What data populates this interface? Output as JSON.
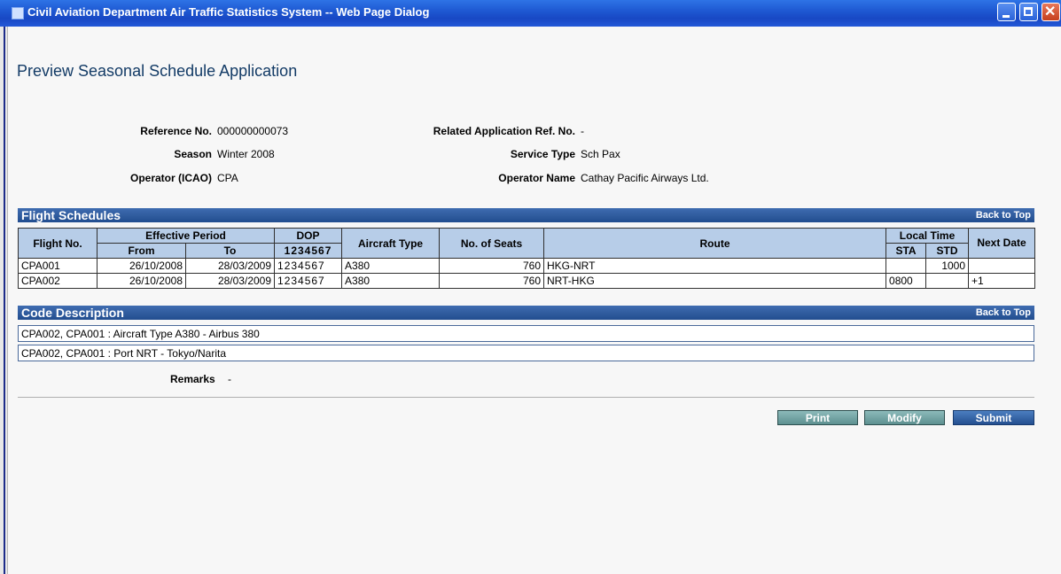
{
  "window": {
    "title": "Civil Aviation Department Air Traffic Statistics System -- Web Page Dialog"
  },
  "page": {
    "title": "Preview Seasonal Schedule Application"
  },
  "summary": {
    "ref_no_label": "Reference No.",
    "ref_no_value": "000000000073",
    "related_label": "Related Application Ref. No.",
    "related_value": "-",
    "season_label": "Season",
    "season_value": "Winter 2008",
    "service_type_label": "Service Type",
    "service_type_value": "Sch Pax",
    "operator_icao_label": "Operator (ICAO)",
    "operator_icao_value": "CPA",
    "operator_name_label": "Operator Name",
    "operator_name_value": "Cathay Pacific Airways Ltd."
  },
  "flight_schedules": {
    "title": "Flight Schedules",
    "back_to_top": "Back to Top",
    "headers": {
      "flight_no": "Flight No.",
      "effective_period": "Effective Period",
      "from": "From",
      "to": "To",
      "dop": "DOP",
      "dop_days": "1234567",
      "aircraft_type": "Aircraft Type",
      "no_of_seats": "No. of Seats",
      "route": "Route",
      "local_time": "Local Time",
      "sta": "STA",
      "std": "STD",
      "next_date": "Next Date"
    },
    "rows": [
      {
        "flight_no": "CPA001",
        "from": "26/10/2008",
        "to": "28/03/2009",
        "dop": "1234567",
        "aircraft": "A380",
        "seats": "760",
        "route": "HKG-NRT",
        "sta": "",
        "std": "1000",
        "next": ""
      },
      {
        "flight_no": "CPA002",
        "from": "26/10/2008",
        "to": "28/03/2009",
        "dop": "1234567",
        "aircraft": "A380",
        "seats": "760",
        "route": "NRT-HKG",
        "sta": "0800",
        "std": "",
        "next": "+1"
      }
    ]
  },
  "code_description": {
    "title": "Code Description",
    "back_to_top": "Back to Top",
    "lines": [
      "CPA002, CPA001 : Aircraft Type A380 - Airbus 380",
      "CPA002, CPA001 : Port NRT - Tokyo/Narita"
    ]
  },
  "remarks": {
    "label": "Remarks",
    "value": "-"
  },
  "buttons": {
    "print": "Print",
    "modify": "Modify",
    "submit": "Submit"
  }
}
